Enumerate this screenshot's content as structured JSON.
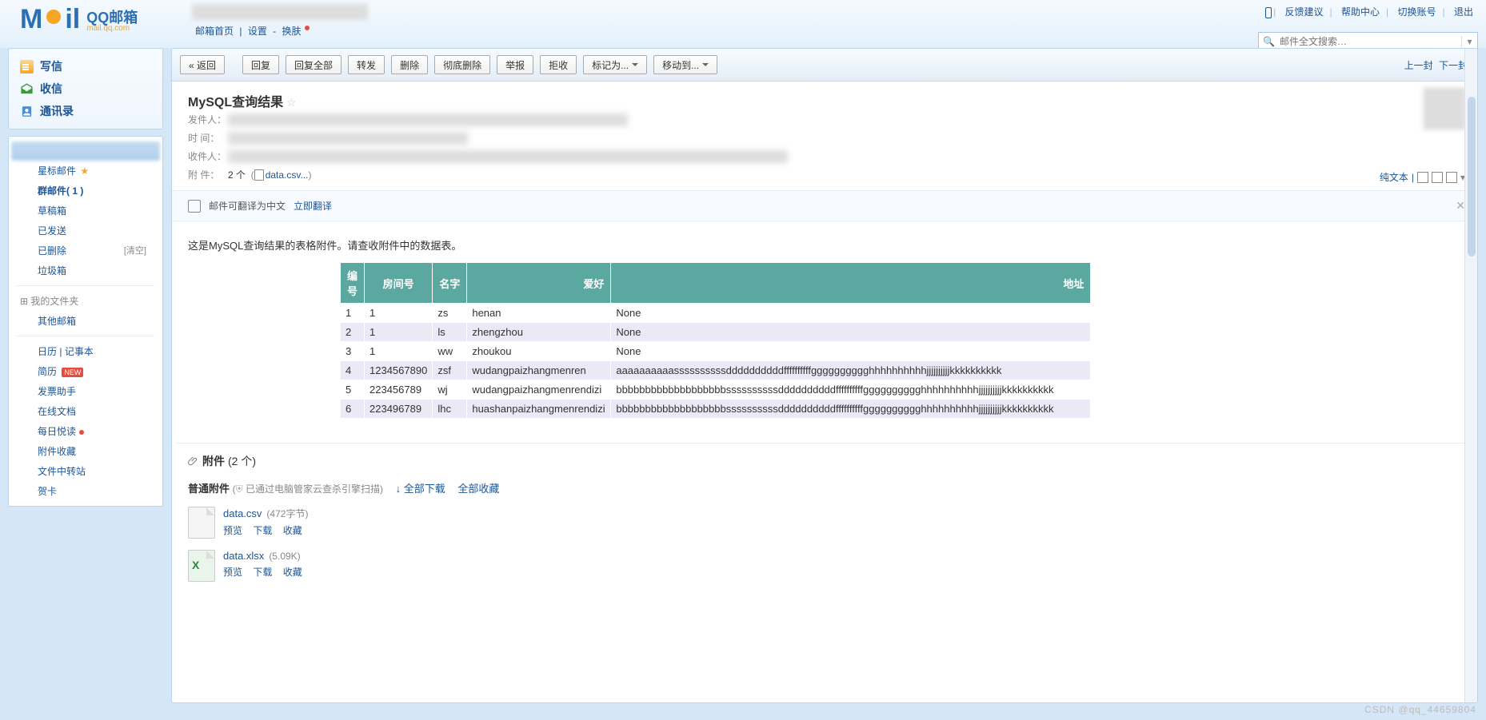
{
  "brand": {
    "qq_text": "QQ邮箱",
    "sub_text": "mail.qq.com"
  },
  "top_nav": {
    "home": "邮箱首页",
    "settings": "设置",
    "skin": "换肤"
  },
  "top_right": {
    "feedback": "反馈建议",
    "help": "帮助中心",
    "switch": "切换账号",
    "logout": "退出"
  },
  "search": {
    "placeholder": "邮件全文搜索…"
  },
  "side_actions": {
    "compose": "写信",
    "inbox": "收信",
    "contacts": "通讯录"
  },
  "folders": {
    "starred": "星标邮件",
    "group": "群邮件",
    "group_count": "( 1 )",
    "draft": "草稿箱",
    "sent": "已发送",
    "deleted": "已删除",
    "clear": "[清空]",
    "spam": "垃圾箱",
    "myfolders": "我的文件夹",
    "other": "其他邮箱",
    "calendar": "日历",
    "notes": "记事本",
    "resume": "简历",
    "new_badge": "NEW",
    "invoice": "发票助手",
    "onlinedoc": "在线文档",
    "daily": "每日悦读",
    "attachcol": "附件收藏",
    "transfer": "文件中转站",
    "card": "贺卡"
  },
  "toolbar": {
    "back": "« 返回",
    "reply": "回复",
    "reply_all": "回复全部",
    "forward": "转发",
    "delete": "删除",
    "purge": "彻底删除",
    "report": "举报",
    "reject": "拒收",
    "mark": "标记为...",
    "move": "移动到...",
    "prev": "上一封",
    "next": "下一封"
  },
  "mail": {
    "subject": "MySQL查询结果",
    "from_lbl": "发件人",
    "time_lbl": "时   间",
    "to_lbl": "收件人",
    "attach_lbl": "附   件",
    "attach_count": "2 个",
    "attach_name": "data.csv...",
    "plaintext": "纯文本"
  },
  "translate": {
    "text": "邮件可翻译为中文",
    "link": "立即翻译"
  },
  "body_text": "这是MySQL查询结果的表格附件。请查收附件中的数据表。",
  "table": {
    "headers": [
      "编号",
      "房间号",
      "名字",
      "爱好",
      "地址"
    ],
    "rows": [
      [
        "1",
        "1",
        "zs",
        "henan",
        "None"
      ],
      [
        "2",
        "1",
        "ls",
        "zhengzhou",
        "None"
      ],
      [
        "3",
        "1",
        "ww",
        "zhoukou",
        "None"
      ],
      [
        "4",
        "1234567890",
        "zsf",
        "wudangpaizhangmenren",
        "aaaaaaaaaassssssssssddddddddddffffffffffgggggggggghhhhhhhhhhjjjjjjjjjjkkkkkkkkkk"
      ],
      [
        "5",
        "223456789",
        "wj",
        "wudangpaizhangmenrendizi",
        "bbbbbbbbbbbbbbbbbbbssssssssssddddddddddffffffffffgggggggggghhhhhhhhhhjjjjjjjjjjkkkkkkkkkk"
      ],
      [
        "6",
        "223496789",
        "lhc",
        "huashanpaizhangmenrendizi",
        "bbbbbbbbbbbbbbbbbbbssssssssssddddddddddffffffffffgggggggggghhhhhhhhhhjjjjjjjjjjkkkkkkkkkk"
      ]
    ]
  },
  "attachments": {
    "title": "附件",
    "count_text": "(2 个)",
    "normal_lbl": "普通附件",
    "scan_hint": "已通过电脑管家云查杀引擎扫描",
    "download_all": "全部下载",
    "collect_all": "全部收藏",
    "actions": {
      "preview": "预览",
      "download": "下载",
      "collect": "收藏"
    },
    "files": [
      {
        "name": "data.csv",
        "size": "(472字节)"
      },
      {
        "name": "data.xlsx",
        "size": "(5.09K)"
      }
    ],
    "dl_arrow": "↓"
  },
  "watermark": "CSDN @qq_44659804"
}
